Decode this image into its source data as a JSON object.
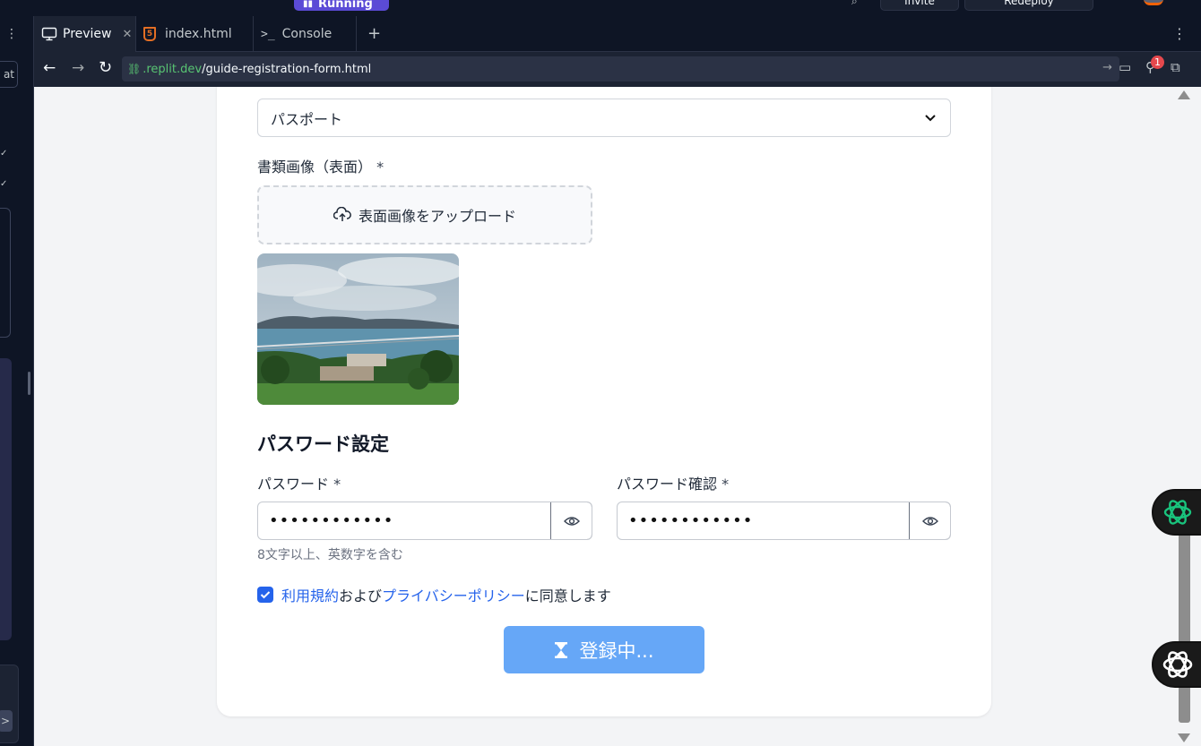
{
  "topbar": {
    "run_status": "Running",
    "invite_label": "Invite",
    "redeploy_label": "Redeploy"
  },
  "left_rail": {
    "chat_label": "at"
  },
  "tabs": [
    {
      "label": "Preview",
      "icon": "monitor-icon",
      "active": true
    },
    {
      "label": "index.html",
      "icon": "html5-icon",
      "active": false
    },
    {
      "label": "Console",
      "icon": "terminal-icon",
      "active": false
    }
  ],
  "browser": {
    "url_domain": ".replit.dev",
    "url_path": "/guide-registration-form.html",
    "notification_count": "1"
  },
  "form": {
    "document_type_value": "パスポート",
    "document_image_label": "書類画像（表面）",
    "required_mark": "*",
    "upload_label": "表面画像をアップロード",
    "password_section_title": "パスワード設定",
    "password_label": "パスワード",
    "password_value": "••••••••••••",
    "password_confirm_label": "パスワード確認",
    "password_confirm_value": "••••••••••••",
    "password_hint": "8文字以上、英数字を含む",
    "terms_link": "利用規約",
    "terms_and": "および",
    "privacy_link": "プライバシーポリシー",
    "terms_suffix": "に同意します",
    "terms_checked": true,
    "submit_label": "登録中..."
  },
  "colors": {
    "accent": "#2563eb",
    "submit_bg": "#66a7f7",
    "url_domain": "#58c472"
  }
}
